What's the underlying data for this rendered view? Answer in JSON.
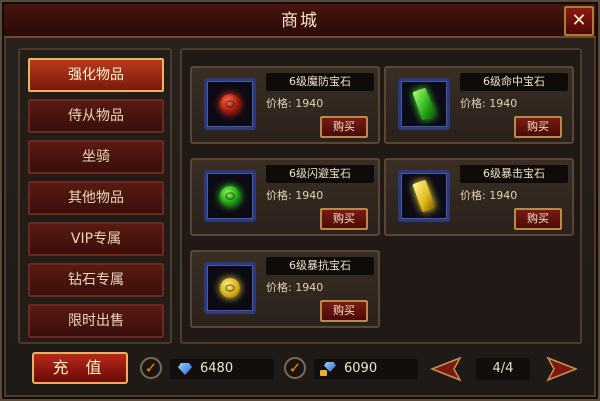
{
  "window": {
    "title": "商城",
    "close_label": "✕"
  },
  "sidebar": {
    "items": [
      {
        "label": "强化物品",
        "active": true
      },
      {
        "label": "侍从物品",
        "active": false
      },
      {
        "label": "坐骑",
        "active": false
      },
      {
        "label": "其他物品",
        "active": false
      },
      {
        "label": "VIP专属",
        "active": false
      },
      {
        "label": "钻石专属",
        "active": false
      },
      {
        "label": "限时出售",
        "active": false
      }
    ]
  },
  "items": [
    {
      "name": "6级魔防宝石",
      "price": "价格: 1940",
      "buy_label": "购买",
      "gem": "red-round-gem-icon",
      "color": "#d02a10"
    },
    {
      "name": "6级命中宝石",
      "price": "价格: 1940",
      "buy_label": "购买",
      "gem": "green-shard-gem-icon",
      "color": "#2ab018"
    },
    {
      "name": "6级闪避宝石",
      "price": "价格: 1940",
      "buy_label": "购买",
      "gem": "green-round-gem-icon",
      "color": "#1a9a10"
    },
    {
      "name": "6级暴击宝石",
      "price": "价格: 1940",
      "buy_label": "购买",
      "gem": "yellow-shard-gem-icon",
      "color": "#e0b818"
    },
    {
      "name": "6级暴抗宝石",
      "price": "价格: 1940",
      "buy_label": "购买",
      "gem": "yellow-round-gem-icon",
      "color": "#d0a810"
    }
  ],
  "footer": {
    "recharge_label": "充 值",
    "diamond_check": "✓",
    "diamonds": "6480",
    "bound_diamond_check": "✓",
    "bound_diamonds": "6090",
    "page": "4/4"
  },
  "colors": {
    "accent": "#e8b460",
    "button_red": "#7a1a12",
    "check_orange": "#ff8a1a"
  }
}
